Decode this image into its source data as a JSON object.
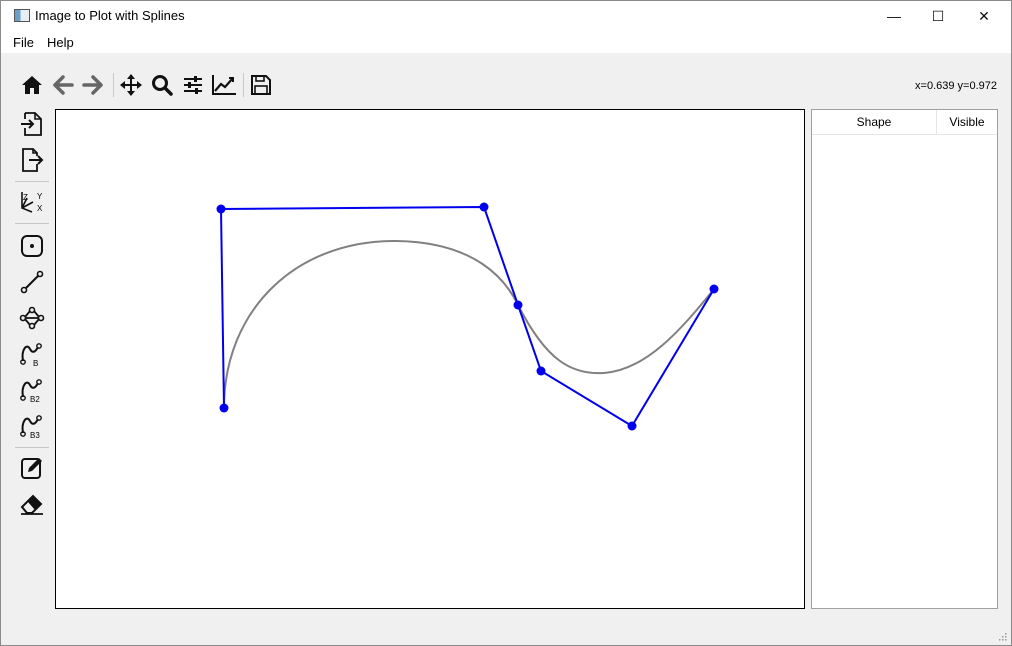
{
  "window": {
    "title": "Image to Plot with Splines",
    "controls": {
      "minimize": "—",
      "maximize": "☐",
      "close": "✕"
    }
  },
  "menu": {
    "items": [
      "File",
      "Help"
    ]
  },
  "toolbar": {
    "buttons": [
      "home-icon",
      "back-arrow-icon",
      "forward-arrow-icon",
      "pan-move-icon",
      "zoom-magnifier-icon",
      "configure-subplots-icon",
      "edit-axis-curve-icon",
      "save-icon"
    ],
    "coords": "x=0.639 y=0.972"
  },
  "sidebar": {
    "buttons": [
      "import-icon",
      "export-icon",
      "axes-zyx-icon",
      "point-icon",
      "line-icon",
      "polyline-icon",
      "bspline-icon",
      "bspline-2-icon",
      "bspline-3-icon",
      "edit-icon",
      "eraser-icon"
    ],
    "labels": {
      "axes_z": "Z",
      "axes_y": "Y",
      "axes_x": "X",
      "b1": "B",
      "b2": "B2",
      "b3": "B3"
    }
  },
  "panel": {
    "headers": {
      "shape": "Shape",
      "visible": "Visible"
    }
  },
  "colors": {
    "control_polygon": "#0000ee",
    "spline": "#808080",
    "canvas_bg": "#ffffff"
  }
}
